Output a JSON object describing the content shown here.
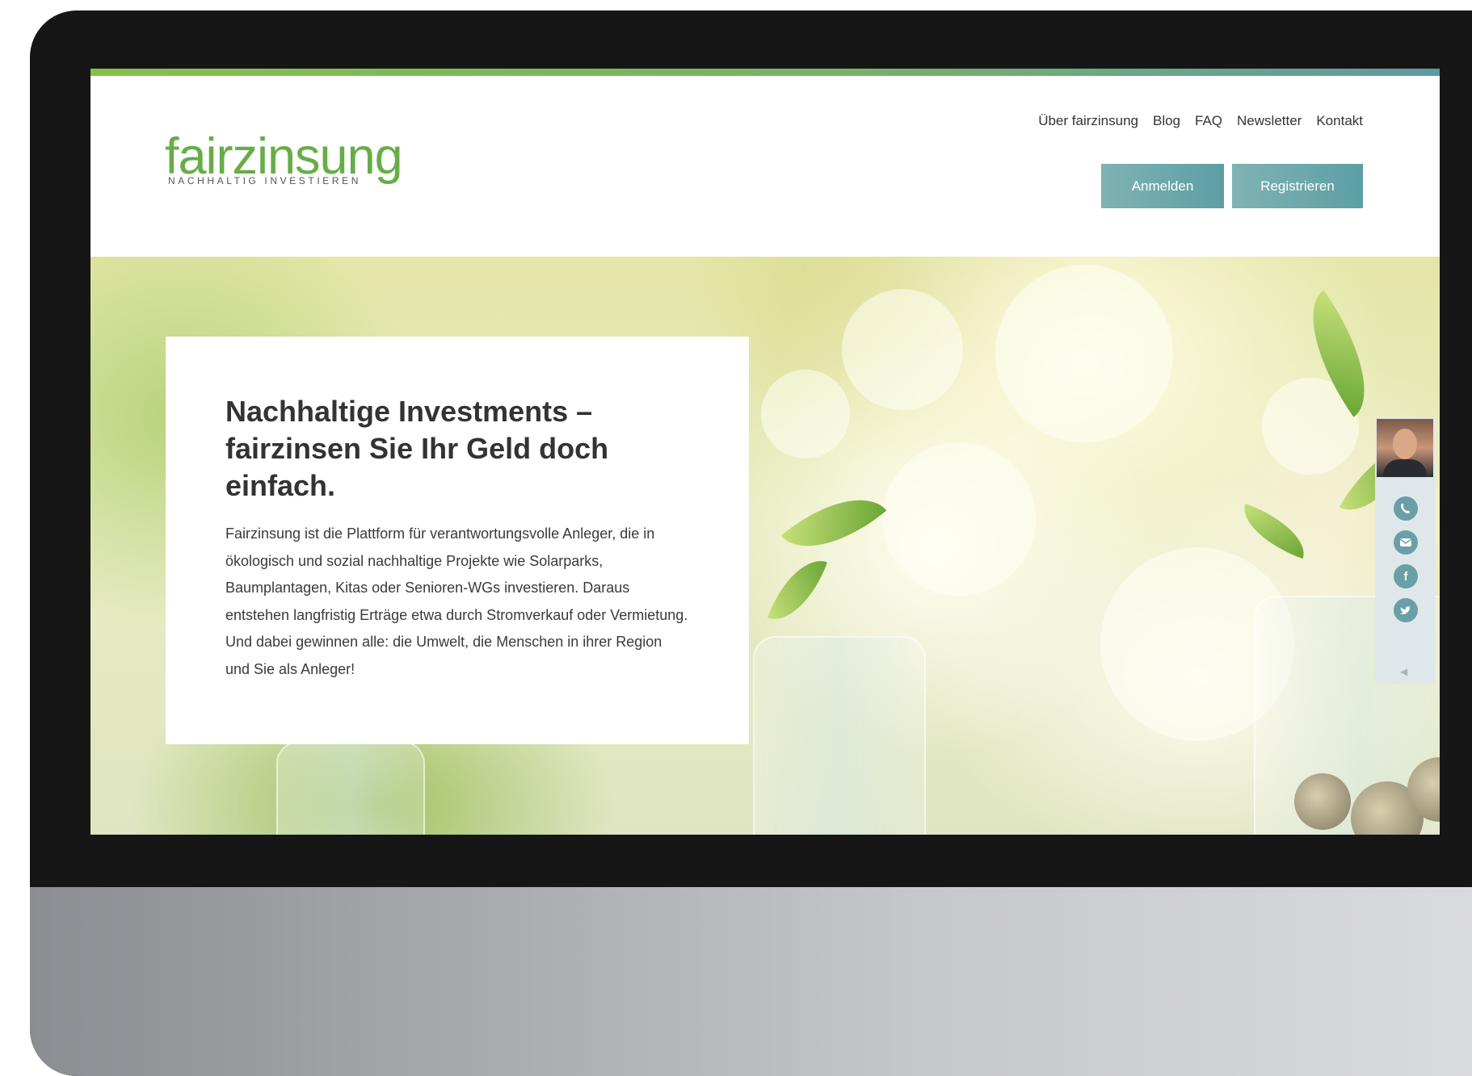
{
  "header": {
    "logo_word": "fairzinsung",
    "logo_tagline": "NACHHALTIG INVESTIEREN",
    "nav": [
      "Über fairzinsung",
      "Blog",
      "FAQ",
      "Newsletter",
      "Kontakt"
    ],
    "login_label": "Anmelden",
    "register_label": "Registrieren"
  },
  "hero": {
    "title": "Nachhaltige Investments – fairzinsen Sie Ihr Geld doch einfach.",
    "body": "Fairzinsung ist die Plattform für verantwortungsvolle Anleger, die in ökologisch und sozial nachhaltige Projekte wie Solarparks, Baumplantagen, Kitas oder Senioren-WGs investieren. Daraus entstehen langfristig Erträge etwa durch Stromverkauf oder Vermietung. Und dabei gewinnen alle: die Umwelt, die Menschen in ihrer Region und Sie als Anleger!"
  },
  "contact_widget": {
    "icons": [
      "phone-icon",
      "mail-icon",
      "facebook-icon",
      "twitter-icon"
    ],
    "fb_glyph": "f"
  },
  "colors": {
    "brand_green": "#66ad48",
    "button_teal": "#6aa3aa",
    "frame": "#161616"
  }
}
